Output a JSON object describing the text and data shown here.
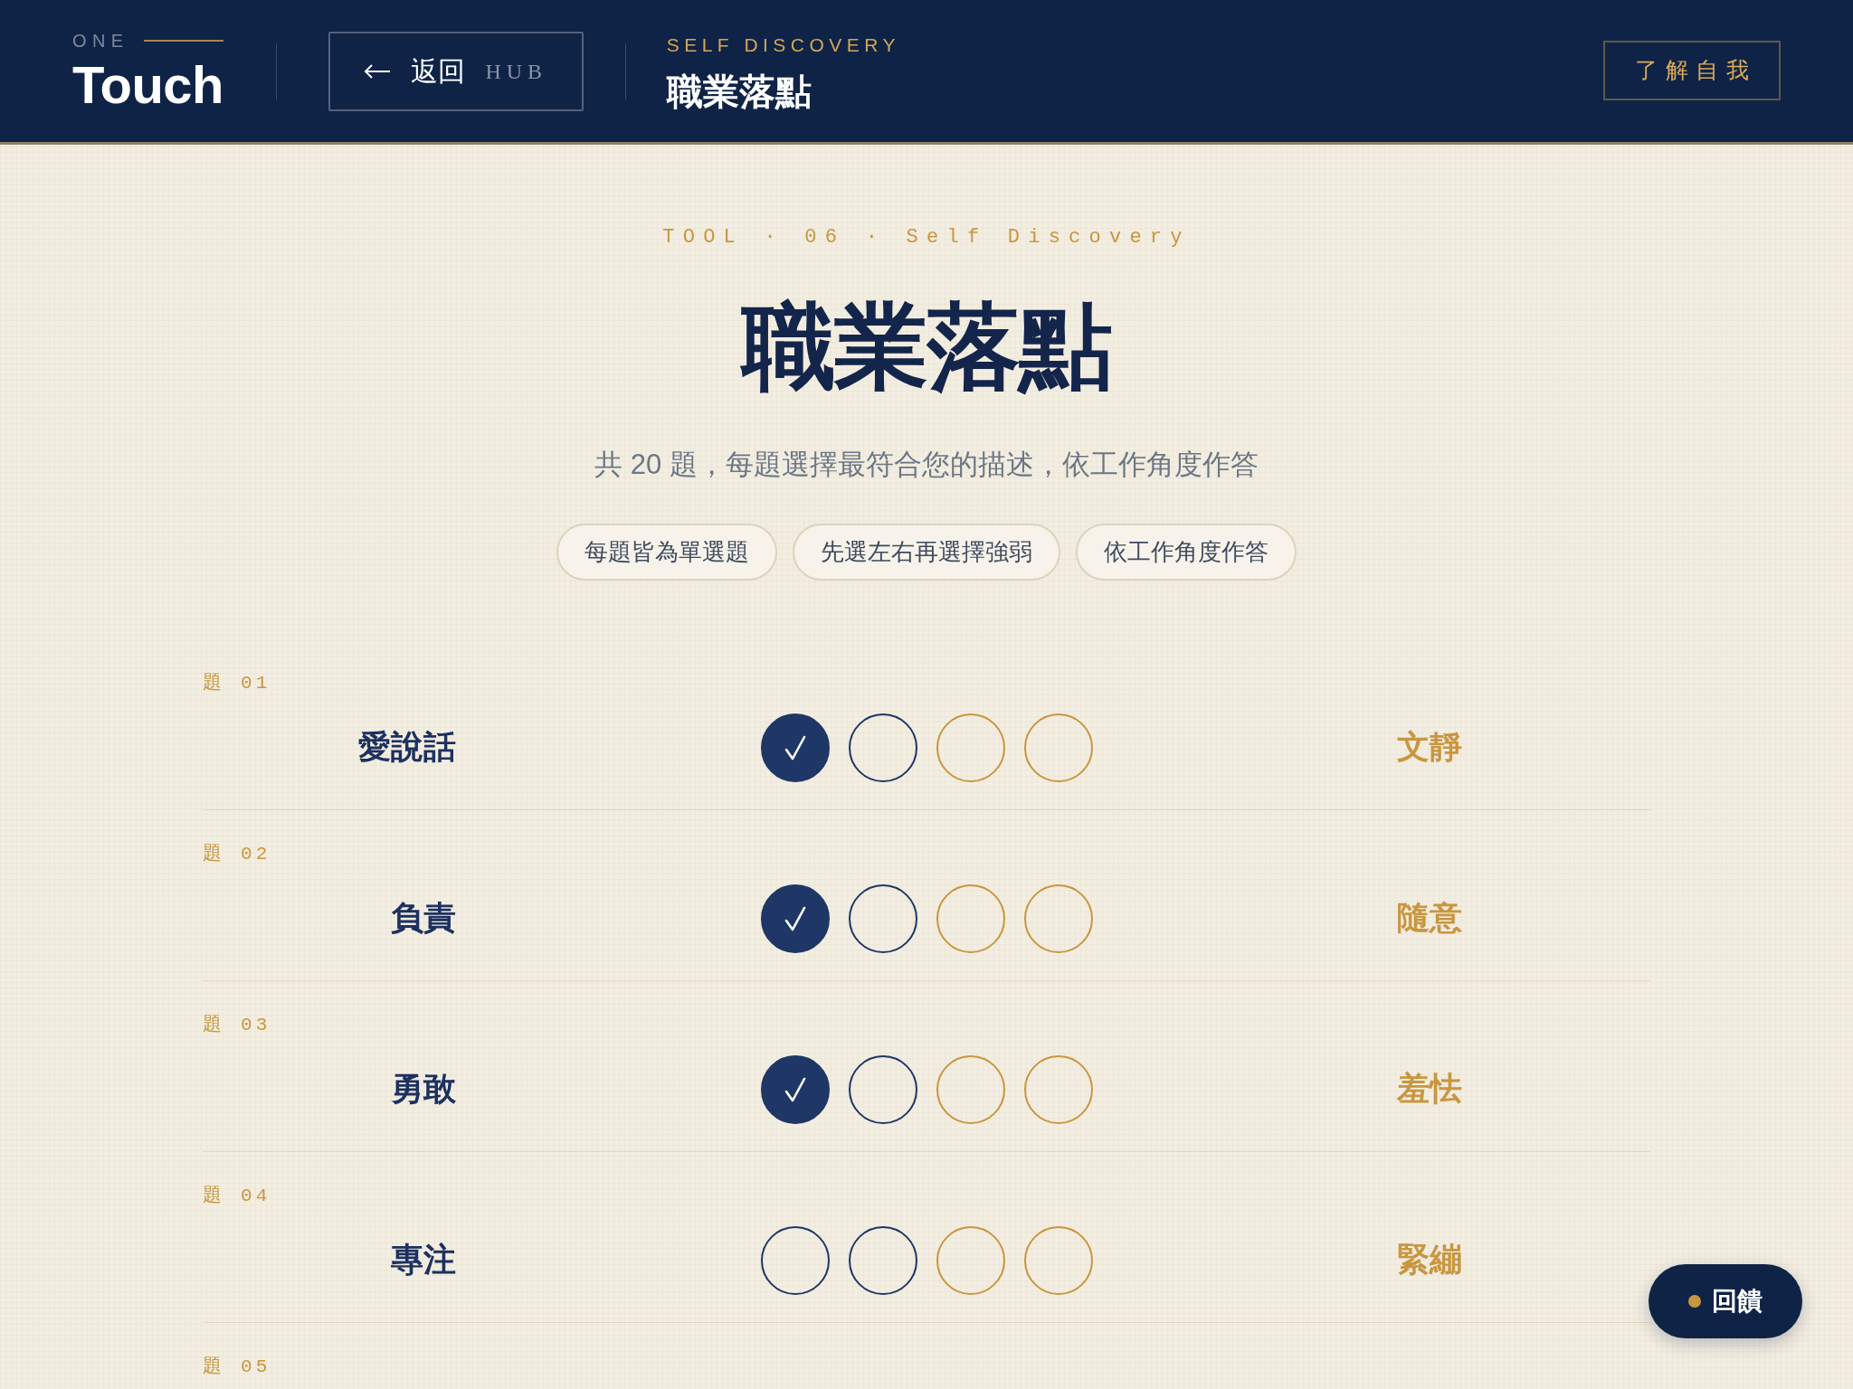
{
  "header": {
    "logo": {
      "caption": "ONE",
      "wordmark": "Touch"
    },
    "back_button": {
      "label": "返回",
      "suffix": "HUB"
    },
    "section": {
      "eyebrow": "SELF DISCOVERY",
      "title": "職業落點"
    },
    "about_button": "了解自我"
  },
  "intro": {
    "eyebrow": "TOOL · 06 · Self Discovery",
    "title": "職業落點",
    "subtitle": "共 20 題，每題選擇最符合您的描述，依工作角度作答",
    "chips": [
      "每題皆為單選題",
      "先選左右再選擇強弱",
      "依工作角度作答"
    ]
  },
  "questions": [
    {
      "label": "題 01",
      "left": "愛說話",
      "right": "文靜",
      "options": [
        {
          "kind": "left",
          "selected": true
        },
        {
          "kind": "left",
          "selected": false
        },
        {
          "kind": "right",
          "selected": false
        },
        {
          "kind": "right",
          "selected": false
        }
      ]
    },
    {
      "label": "題 02",
      "left": "負責",
      "right": "隨意",
      "options": [
        {
          "kind": "left",
          "selected": true
        },
        {
          "kind": "left",
          "selected": false
        },
        {
          "kind": "right",
          "selected": false
        },
        {
          "kind": "right",
          "selected": false
        }
      ]
    },
    {
      "label": "題 03",
      "left": "勇敢",
      "right": "羞怯",
      "options": [
        {
          "kind": "left",
          "selected": true
        },
        {
          "kind": "left",
          "selected": false
        },
        {
          "kind": "right",
          "selected": false
        },
        {
          "kind": "right",
          "selected": false
        }
      ]
    },
    {
      "label": "題 04",
      "left": "專注",
      "right": "緊繃",
      "options": [
        {
          "kind": "left",
          "selected": false
        },
        {
          "kind": "left",
          "selected": false
        },
        {
          "kind": "right",
          "selected": false
        },
        {
          "kind": "right",
          "selected": false
        }
      ]
    },
    {
      "label": "題 05"
    }
  ],
  "feedback_button": {
    "label": "回饋"
  }
}
